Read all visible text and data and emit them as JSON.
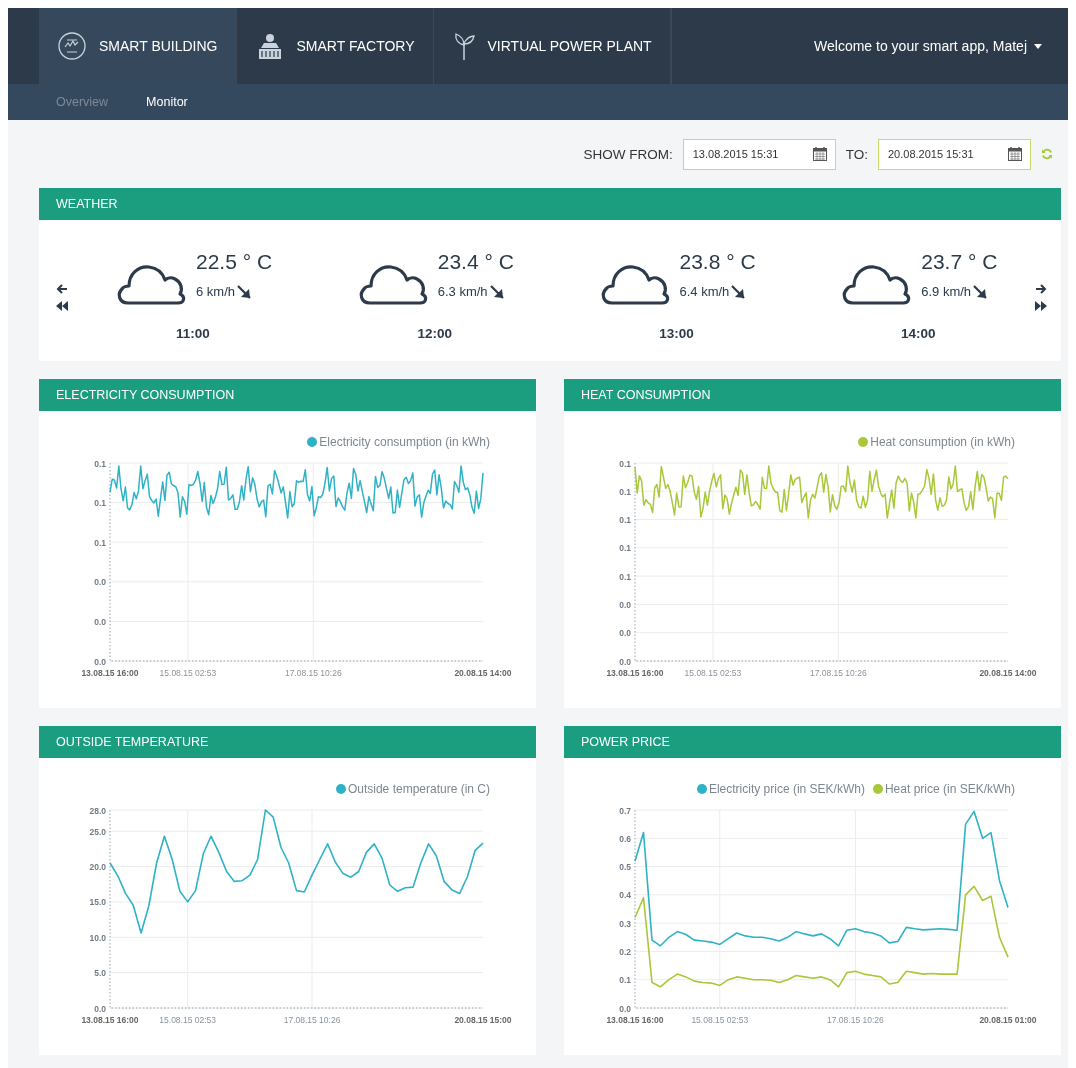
{
  "header": {
    "nav": [
      {
        "label": "SMART BUILDING",
        "kind": "building",
        "selected": true
      },
      {
        "label": "SMART FACTORY",
        "kind": "factory",
        "selected": false
      },
      {
        "label": "VIRTUAL POWER PLANT",
        "kind": "plant",
        "selected": false
      }
    ],
    "user": "Welcome to your smart app, Matej"
  },
  "subnav": [
    {
      "label": "Overview",
      "selected": false
    },
    {
      "label": "Monitor",
      "selected": true
    }
  ],
  "filter": {
    "from_label": "SHOW FROM:",
    "from": "13.08.2015 15:31",
    "to_label": "TO:",
    "to": "20.08.2015 15:31"
  },
  "weather": {
    "title": "WEATHER",
    "forecasts": [
      {
        "temperature": "22.5 ° C",
        "wind": "6 km/h",
        "time": "11:00"
      },
      {
        "temperature": "23.4 ° C",
        "wind": "6.3 km/h",
        "time": "12:00"
      },
      {
        "temperature": "23.8 ° C",
        "wind": "6.4 km/h",
        "time": "13:00"
      },
      {
        "temperature": "23.7 ° C",
        "wind": "6.9 km/h",
        "time": "14:00"
      }
    ]
  },
  "panels": [
    {
      "title": "ELECTRICITY CONSUMPTION",
      "kind": "picture",
      "legend": [
        {
          "label": "Electricity consumption (in kWh)",
          "color": "#2fb2c6"
        }
      ],
      "y_tick_labels": [
        "0.1",
        "0.1",
        "0.1",
        "0.0",
        "0.0",
        "0.0"
      ],
      "x_tick_labels": [
        "13.08.15 16:00",
        "15.08.15 02:53",
        "17.08.15 10:26",
        "20.08.15 14:00"
      ]
    },
    {
      "title": "HEAT CONSUMPTION",
      "kind": "picture",
      "legend": [
        {
          "label": "Heat consumption (in kWh)",
          "color": "#a8c83a"
        }
      ],
      "y_tick_labels": [
        "0.1",
        "0.1",
        "0.1",
        "0.1",
        "0.1",
        "0.0",
        "0.0",
        "0.0"
      ],
      "x_tick_labels": [
        "13.08.15 16:00",
        "15.08.15 02:53",
        "17.08.15 10:26",
        "20.08.15 14:00"
      ]
    },
    {
      "title": "OUTSIDE TEMPERATURE",
      "kind": "chart",
      "chart_data": {
        "type": "line",
        "categories": [
          "13.08.15 16:00",
          null,
          null,
          null,
          null,
          null,
          null,
          null,
          null,
          null,
          "15.08.15 02:53",
          null,
          null,
          null,
          null,
          null,
          null,
          null,
          null,
          null,
          null,
          null,
          null,
          null,
          null,
          null,
          "17.08.15 10:26",
          null,
          null,
          null,
          null,
          null,
          null,
          null,
          null,
          null,
          null,
          null,
          null,
          null,
          null,
          null,
          null,
          null,
          null,
          null,
          null,
          null,
          "20.08.15 15:00"
        ],
        "series": [
          {
            "name": "Outside temperature (in C)",
            "color": "#2fb2c6",
            "values": [
              20.5,
              18.7,
              16.2,
              14.5,
              10.6,
              14.5,
              20.5,
              24.3,
              21,
              16.5,
              15,
              16.6,
              21.8,
              24.3,
              22,
              19.3,
              17.9,
              18,
              18.8,
              21,
              28,
              27,
              22.7,
              20.5,
              16.6,
              16.4,
              18.8,
              21,
              23.2,
              20.6,
              19,
              18.5,
              19.3,
              22,
              23.2,
              21.2,
              17.4,
              16.5,
              17,
              17.1,
              20.5,
              23.2,
              21.5,
              17.9,
              16.7,
              16.2,
              18.6,
              22.3,
              23.3
            ]
          }
        ],
        "grid": true,
        "ylim": [
          0,
          28
        ],
        "yticks": [
          {
            "value": 0,
            "label": "0.0"
          },
          {
            "value": 5,
            "label": "5.0"
          },
          {
            "value": 10,
            "label": "10.0"
          },
          {
            "value": 15,
            "label": "15.0"
          },
          {
            "value": 20,
            "label": "20.0"
          },
          {
            "value": 25,
            "label": "25.0"
          },
          {
            "value": 28,
            "label": "28.0"
          }
        ]
      }
    },
    {
      "title": "POWER PRICE",
      "kind": "chart",
      "chart_data": {
        "type": "line",
        "categories": [
          "13.08.15 16:00",
          null,
          null,
          null,
          null,
          null,
          null,
          null,
          null,
          null,
          "15.08.15 02:53",
          null,
          null,
          null,
          null,
          null,
          null,
          null,
          null,
          null,
          null,
          null,
          null,
          null,
          null,
          null,
          "17.08.15 10:26",
          null,
          null,
          null,
          null,
          null,
          null,
          null,
          null,
          null,
          null,
          null,
          null,
          null,
          null,
          null,
          null,
          null,
          "20.08.15 01:00"
        ],
        "series": [
          {
            "name": "Electricity price (in SEK/kWh)",
            "color": "#2fb2c6",
            "values": [
              0.52,
              0.62,
              0.24,
              0.22,
              0.25,
              0.27,
              0.26,
              0.24,
              0.237,
              0.233,
              0.225,
              0.245,
              0.265,
              0.255,
              0.25,
              0.25,
              0.245,
              0.237,
              0.25,
              0.27,
              0.262,
              0.255,
              0.262,
              0.245,
              0.22,
              0.275,
              0.28,
              0.27,
              0.265,
              0.255,
              0.23,
              0.235,
              0.285,
              0.28,
              0.276,
              0.278,
              0.28,
              0.278,
              0.275,
              0.65,
              0.695,
              0.6,
              0.62,
              0.45,
              0.355
            ]
          },
          {
            "name": "Heat price (in SEK/kWh)",
            "color": "#a8c83a",
            "values": [
              0.32,
              0.39,
              0.09,
              0.075,
              0.1,
              0.12,
              0.11,
              0.095,
              0.09,
              0.088,
              0.08,
              0.1,
              0.11,
              0.105,
              0.1,
              0.1,
              0.098,
              0.09,
              0.1,
              0.115,
              0.11,
              0.105,
              0.11,
              0.1,
              0.075,
              0.125,
              0.13,
              0.12,
              0.115,
              0.11,
              0.085,
              0.09,
              0.13,
              0.125,
              0.12,
              0.122,
              0.12,
              0.12,
              0.12,
              0.4,
              0.43,
              0.38,
              0.395,
              0.25,
              0.18
            ]
          }
        ],
        "grid": true,
        "ylim": [
          0,
          0.7
        ],
        "yticks": [
          {
            "value": 0,
            "label": "0.0"
          },
          0.1,
          0.2,
          0.3,
          0.4,
          0.5,
          0.6,
          0.7
        ]
      }
    }
  ]
}
